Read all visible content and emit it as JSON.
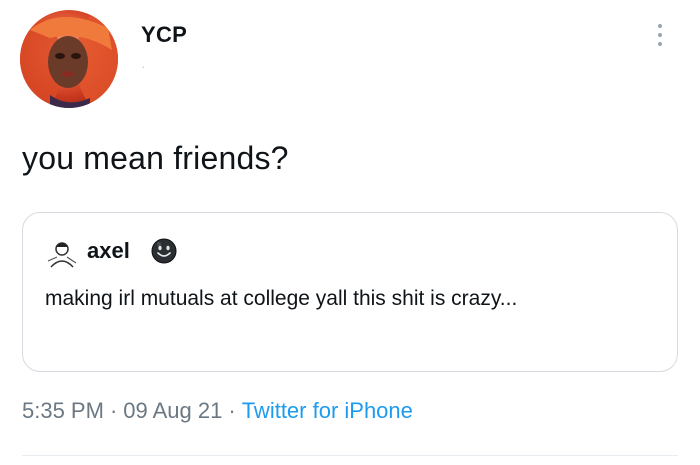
{
  "tweet": {
    "display_name": "YCP",
    "handle": "·",
    "text": "you mean friends?",
    "avatar_icon": "profile-photo-orange-hair"
  },
  "quote": {
    "display_name": "axel",
    "name_emoji": "smiling-face-dark-emoji",
    "handle": "",
    "text": "making irl mutuals at college yall this shit is crazy..."
  },
  "meta": {
    "time": "5:35 PM",
    "separator": "·",
    "date": "09 Aug 21",
    "source": "Twitter for iPhone"
  },
  "colors": {
    "link": "#1d9bf0",
    "muted": "#6b7883",
    "border": "#d5dbe0"
  }
}
